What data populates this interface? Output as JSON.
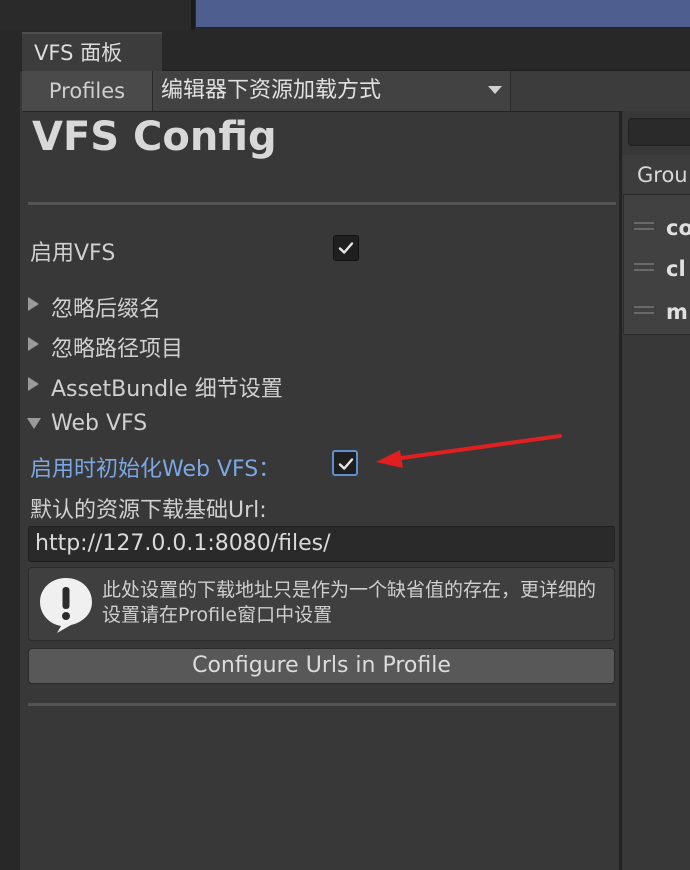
{
  "window": {
    "tab_title": "VFS 面板"
  },
  "toolbar": {
    "profiles_label": "Profiles",
    "dropdown_value": "编辑器下资源加载方式"
  },
  "config": {
    "title": "VFS Config",
    "enable_vfs_label": "启用VFS",
    "enable_vfs_checked": true,
    "foldouts": [
      {
        "label": "忽略后缀名",
        "expanded": false
      },
      {
        "label": "忽略路径项目",
        "expanded": false
      },
      {
        "label": "AssetBundle 细节设置",
        "expanded": false
      },
      {
        "label": "Web VFS",
        "expanded": true
      }
    ],
    "init_web_vfs_label": "启用时初始化Web VFS：",
    "init_web_vfs_checked": true,
    "default_url_label": "默认的资源下载基础Url:",
    "default_url_value": "http://127.0.0.1:8080/files/",
    "help_text": "此处设置的下载地址只是作为一个缺省值的存在，更详细的设置请在Profile窗口中设置",
    "configure_button": "Configure Urls in Profile"
  },
  "right_panel": {
    "header": "Grou",
    "items": [
      "co",
      "cl",
      "m"
    ]
  },
  "colors": {
    "highlight_label": "#7ba7e3",
    "annotation_arrow": "#e02020"
  }
}
